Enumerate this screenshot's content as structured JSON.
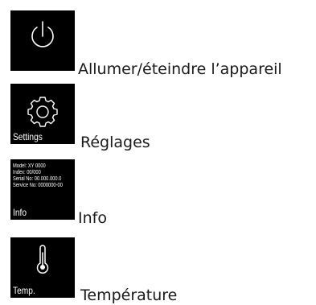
{
  "items": [
    {
      "icon": "power-icon",
      "tile_label": "",
      "caption": "Allumer/éteindre l’appareil"
    },
    {
      "icon": "gear-icon",
      "tile_label": "Settings",
      "caption": "Réglages"
    },
    {
      "icon": "",
      "tile_label": "Info",
      "info_lines": [
        "Model: XY 0000",
        "Index: 00/000",
        "Serial No: 00.000.000.0",
        "Service No: 0000000-00"
      ],
      "caption": "Info"
    },
    {
      "icon": "thermometer-icon",
      "tile_label": "Temp.",
      "caption": "Température"
    }
  ],
  "colors": {
    "tile_background": "#000000",
    "tile_foreground": "#ffffff",
    "caption_text": "#1a1a1a"
  }
}
